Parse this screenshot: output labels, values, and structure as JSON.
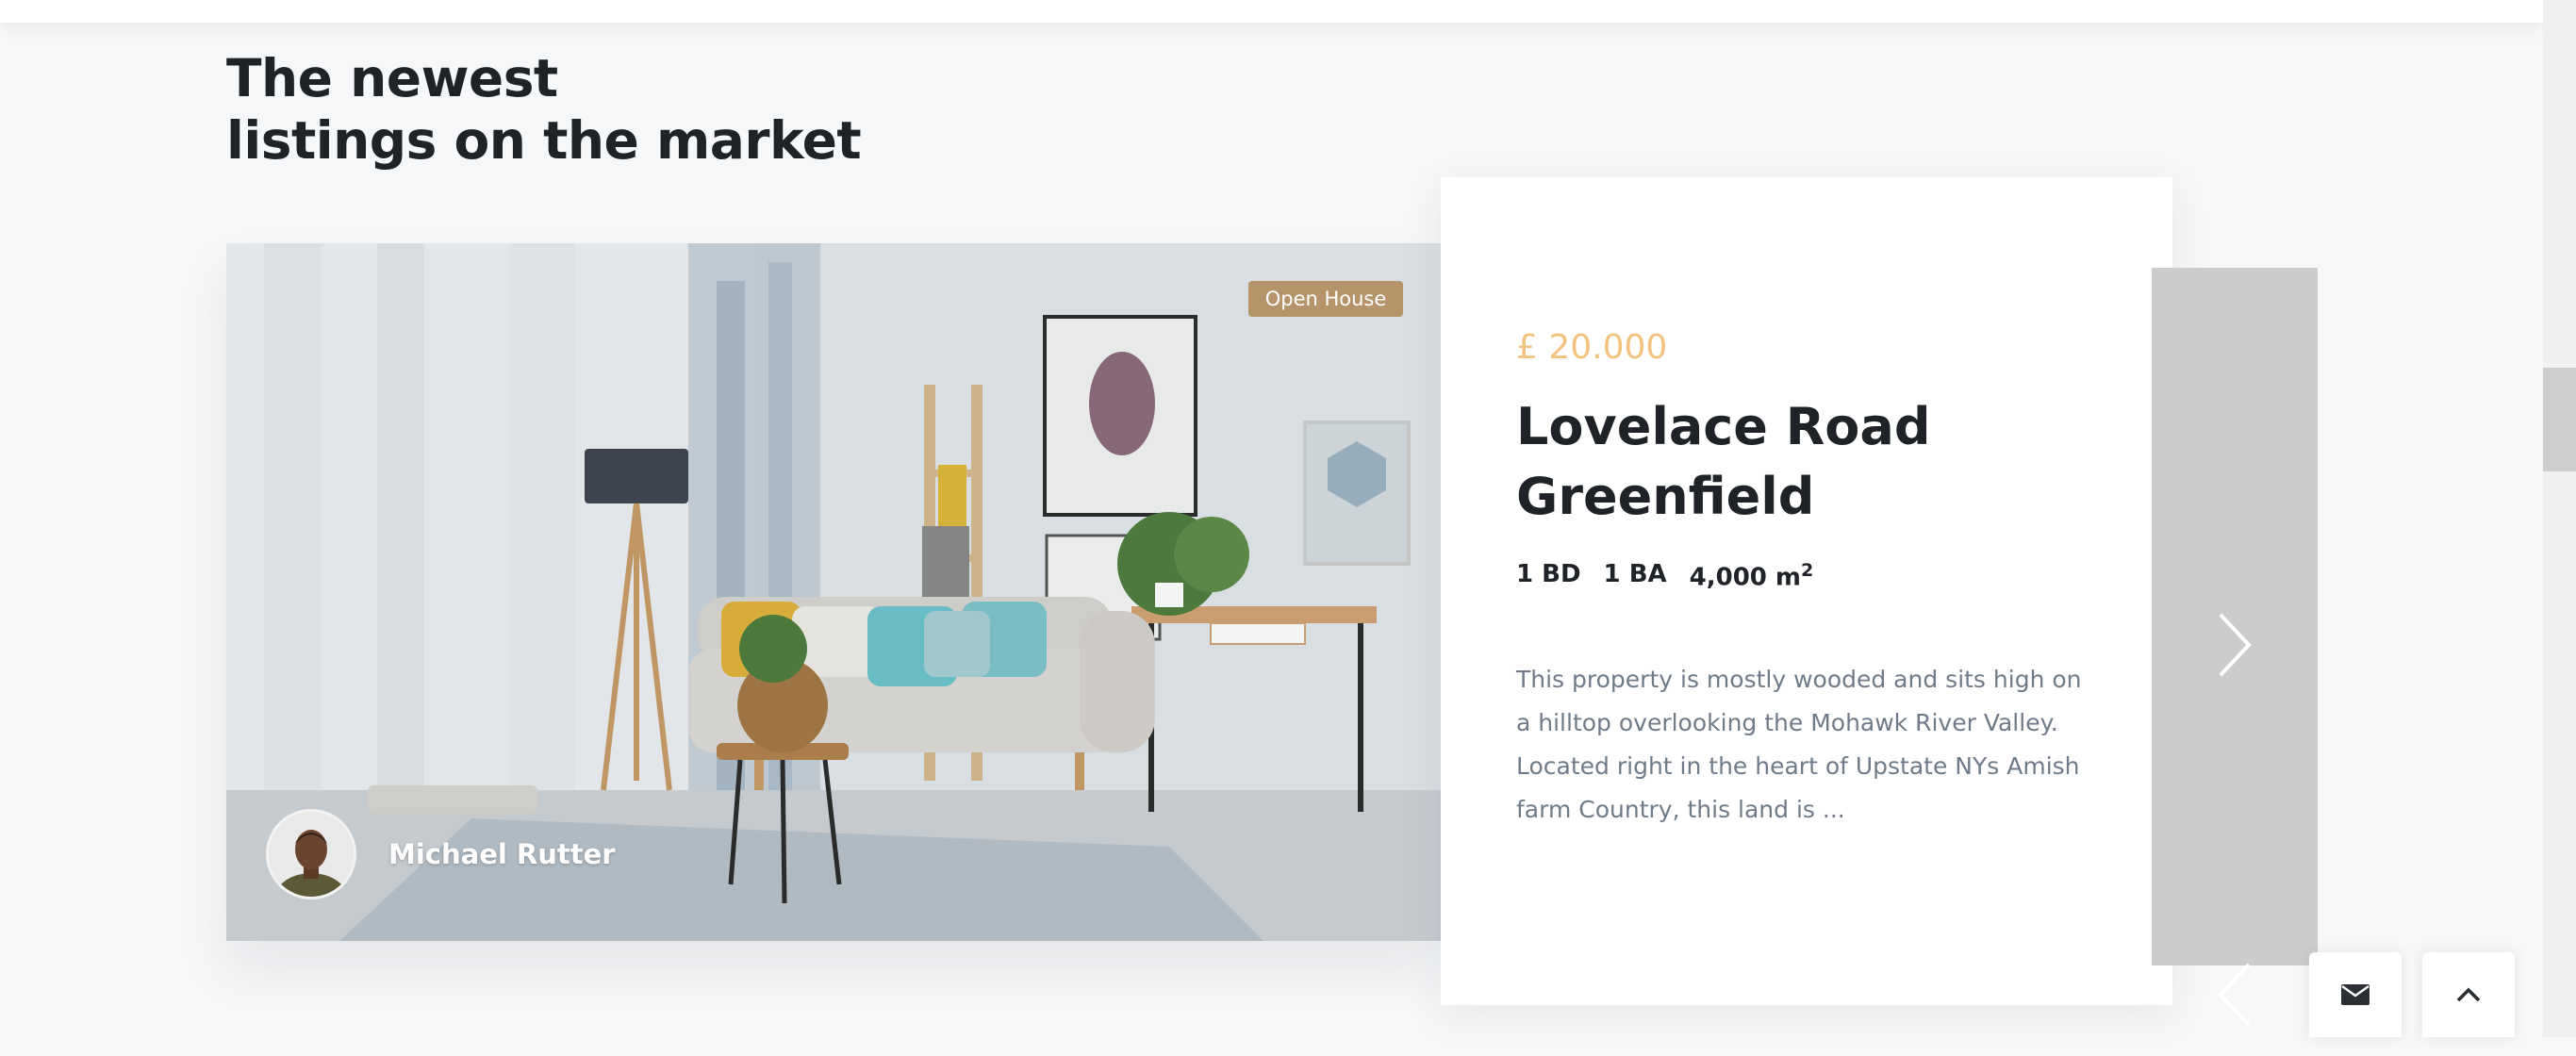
{
  "section": {
    "heading_line1": "The newest",
    "heading_line2": "listings on the market"
  },
  "listing": {
    "badge": "Open House",
    "agent_name": "Michael Rutter",
    "price": "£ 20.000",
    "title_line1": "Lovelace Road",
    "title_line2": "Greenfield",
    "specs": {
      "bedrooms": "1 BD",
      "bathrooms": "1 BA",
      "area": "4,000 m",
      "area_unit_sup": "2"
    },
    "description": "This property is mostly wooded and sits high on a hilltop overlooking the Mohawk River Valley. Located right in the heart of Upstate NYs Amish farm Country, this land is ..."
  },
  "icons": {
    "next": "chevron-right-icon",
    "prev": "chevron-left-icon",
    "mail": "envelope-icon",
    "scroll_top": "chevron-up-icon"
  },
  "colors": {
    "price": "#f2c27e",
    "badge_bg": "#b59469",
    "heading": "#1f2328",
    "description": "#6f7b88",
    "slider_panel": "#cccccc",
    "page_bg": "#f6f7f8"
  }
}
